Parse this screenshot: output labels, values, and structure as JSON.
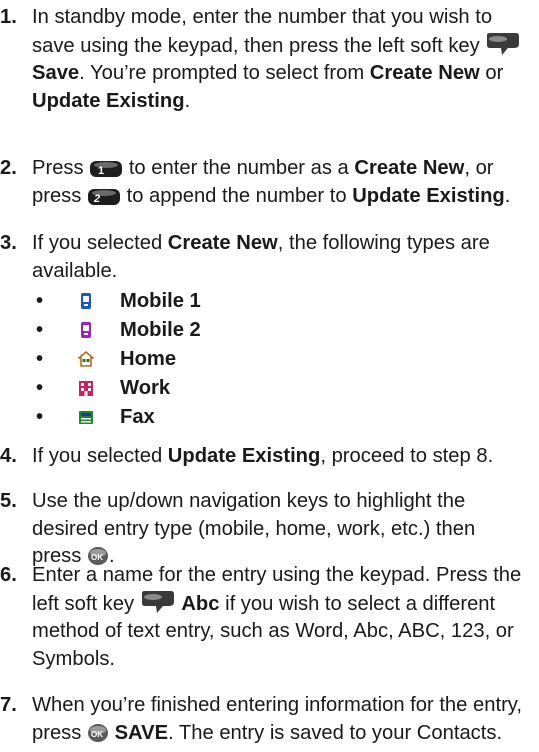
{
  "steps": [
    {
      "number": "1.",
      "p1": "In standby mode, enter the number that you wish to save using the keypad, then press the left soft key",
      "bold1": "Save",
      "p2": ". You’re prompted to select from",
      "bold2": "Create New",
      "p3": "or",
      "bold3": "Update Existing",
      "p4": "."
    },
    {
      "number": "2.",
      "p1": "Press",
      "p2": "to enter the number as a",
      "bold1": "Create New",
      "p3": ", or press",
      "p4": "to append the number to",
      "bold2": "Update Existing",
      "p5": "."
    },
    {
      "number": "3.",
      "p1": "If you selected",
      "bold1": "Create New",
      "p2": ", the following types are available."
    },
    {
      "number": "4.",
      "p1": "If you selected",
      "bold1": "Update Existing",
      "p2": ", proceed to step 8."
    },
    {
      "number": "5.",
      "p1": "Use the up/down navigation keys to highlight the desired entry type (mobile, home, work, etc.) then press",
      "p2": "."
    },
    {
      "number": "6.",
      "p1": "Enter a name for the entry using the keypad. Press the left soft key",
      "bold1": "Abc",
      "p2": "if you wish to select a different method of text entry, such as Word, Abc, ABC, 123, or Symbols."
    },
    {
      "number": "7.",
      "p1": "When you’re finished entering information for the entry, press",
      "bold1": "SAVE",
      "p2": ". The entry is saved to your Contacts."
    }
  ],
  "entry_types": [
    {
      "bullet": "•",
      "label": "Mobile 1",
      "icon": "mobile-phone-icon",
      "color": "#1a56c8"
    },
    {
      "bullet": "•",
      "label": "Mobile 2",
      "icon": "mobile-phone-icon",
      "color": "#a020c0"
    },
    {
      "bullet": "•",
      "label": "Home",
      "icon": "house-icon",
      "color": "#b86a1a"
    },
    {
      "bullet": "•",
      "label": "Work",
      "icon": "office-building-icon",
      "color": "#d0205a"
    },
    {
      "bullet": "•",
      "label": "Fax",
      "icon": "fax-icon",
      "color": "#1a8a2a"
    }
  ],
  "key_icons": {
    "soft_key": "left-soft-key-icon",
    "key_1": "key-1-icon",
    "key_2": "key-2-abc-icon",
    "ok": "ok-button-icon"
  }
}
